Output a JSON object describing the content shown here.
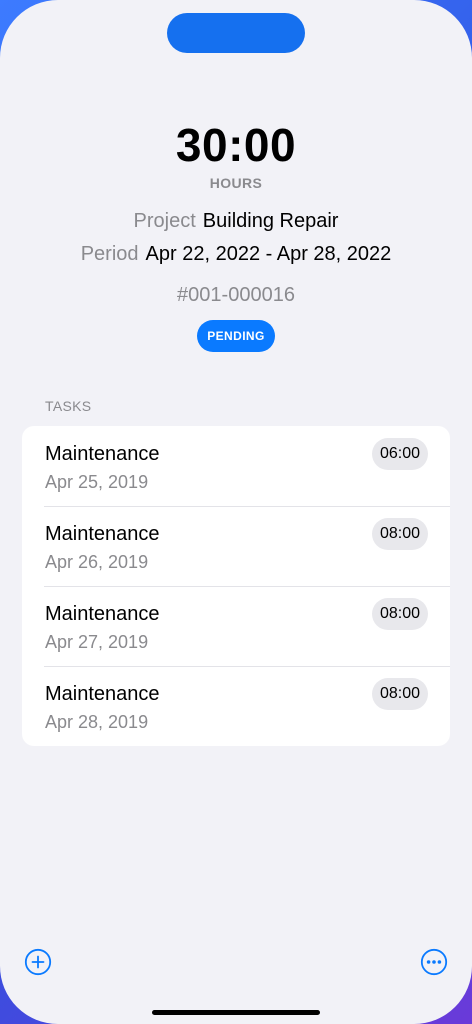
{
  "summary": {
    "total_hours": "30:00",
    "unit_label": "HOURS",
    "project_label": "Project",
    "project_value": "Building Repair",
    "period_label": "Period",
    "period_value": "Apr 22, 2022 - Apr 28, 2022",
    "reference": "#001-000016",
    "status": "PENDING"
  },
  "tasks": {
    "section_title": "TASKS",
    "items": [
      {
        "title": "Maintenance",
        "date": "Apr 25, 2019",
        "hours": "06:00"
      },
      {
        "title": "Maintenance",
        "date": "Apr 26, 2019",
        "hours": "08:00"
      },
      {
        "title": "Maintenance",
        "date": "Apr 27, 2019",
        "hours": "08:00"
      },
      {
        "title": "Maintenance",
        "date": "Apr 28, 2019",
        "hours": "08:00"
      }
    ]
  },
  "toolbar": {
    "add_icon": "plus-circle-icon",
    "more_icon": "ellipsis-circle-icon"
  },
  "colors": {
    "accent": "#0a7aff",
    "background": "#f2f2f7",
    "secondary_text": "#8a8a8e"
  }
}
